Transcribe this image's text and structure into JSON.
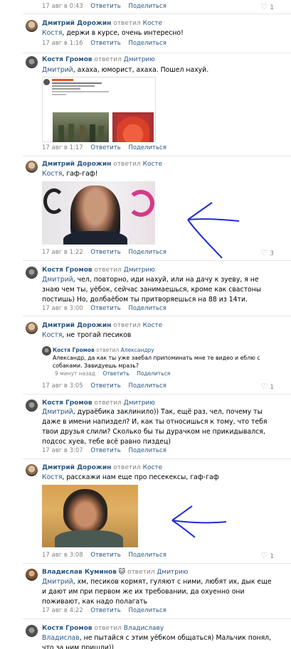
{
  "actions": {
    "reply": "Ответить",
    "share": "Поделиться",
    "replied_to": "ответил"
  },
  "comments": [
    {
      "meta": "17 авг в 0:43",
      "likes": "1"
    },
    {
      "author": "Дмитрий Дорожин",
      "reply_to": "Косте",
      "text_name": "Костя",
      "text": ", держи в курсе, очень интересно!",
      "meta": "17 авг в 1:16"
    },
    {
      "author": "Костя Громов",
      "reply_to": "Дмитрию",
      "text_name": "Дмитрий",
      "text": ", ахаха, юморист, ахаха. Пошел нахуй.",
      "meta": "17 авг в 1:17"
    },
    {
      "author": "Дмитрий Дорожин",
      "reply_to": "Косте",
      "text_name": "Костя",
      "text": ", гаф-гаф!",
      "meta": "17 авг в 1:22",
      "likes": "3"
    },
    {
      "author": "Костя Громов",
      "reply_to": "Дмитрию",
      "text_name": "Дмитрий",
      "text": ", чел, повторно, иди нахуй, или на дачу к зуеву, я не знаю чем ты, уёбок, сейчас занимаешься, кроме как свастоны постишь) Но, долбаёбом ты притворяешься на 88 из 14ти.",
      "meta": "17 авг в 3:00"
    },
    {
      "author": "Дмитрий Дорожин",
      "reply_to": "Косте",
      "text_name": "Костя",
      "text": ", не трогай песиков",
      "meta": "17 авг в 3:05",
      "likes": "1",
      "sub": {
        "author": "Костя Громов",
        "reply_to": "Александру",
        "text_name": "Александр",
        "text": ", да как ты уже заебал припоминать мне те видео и еблю с собаками. Завидуешь мразь?",
        "meta": "9 минут назад"
      }
    },
    {
      "author": "Костя Громов",
      "reply_to": "Дмитрию",
      "text_name": "Дмитрий",
      "text": ", дураёбика заклинило)) Так, ещё раз, чел, почему ты даже в имени напиздел? И, как ты относишься к тому, что тебя твои друзья слили? Сколько бы ты дурачком не прикидывался, подсос хуев, тебе всё равно пиздец)",
      "meta": "17 авг в 3:07"
    },
    {
      "author": "Дмитрий Дорожин",
      "reply_to": "Косте",
      "text_name": "Костя",
      "text": ", расскажи нам еще про песекексы, гаф-гаф",
      "meta": "17 авг в 3:08",
      "likes": "1"
    },
    {
      "author": "Владислав Куминов",
      "author_emoji": "🐱",
      "reply_to": "Дмитрию",
      "text_name": "Дмитрий",
      "text": ", хм, песиков кормят, гуляют с ними, любят их, дык еще и дают им при первом же их требовании, да охуенно они поживают, как надо полагать",
      "meta": "17 авг в 4:22"
    },
    {
      "author": "Костя Громов",
      "reply_to": "Владиславу",
      "text_name": "Владислав",
      "text": ", не пытайся с этим уёбком общаться) Мальчик понял, что за ним пришли))"
    }
  ]
}
